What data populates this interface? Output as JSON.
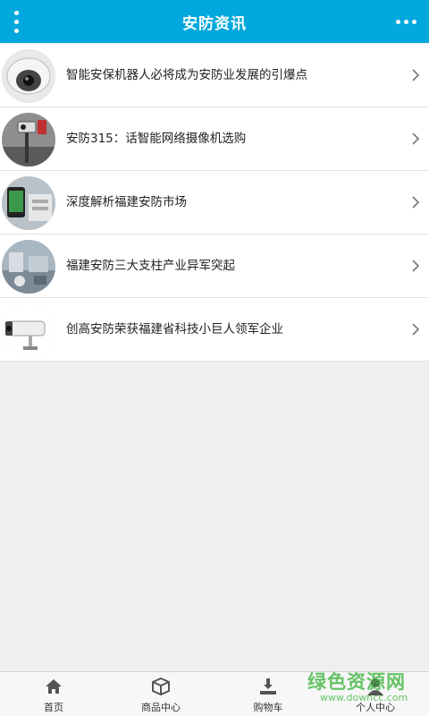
{
  "header": {
    "title": "安防资讯",
    "menu_icon": "vertical-dots-icon",
    "more_icon": "horizontal-dots-icon",
    "color": "#00a8de"
  },
  "news": [
    {
      "title": "智能安保机器人必将成为安防业发展的引爆点",
      "thumb": "dome-camera"
    },
    {
      "title": "安防315：话智能网络摄像机选购",
      "thumb": "camera-on-pole"
    },
    {
      "title": "深度解析福建安防市场",
      "thumb": "phone-device"
    },
    {
      "title": "福建安防三大支柱产业异军突起",
      "thumb": "factory-machines"
    },
    {
      "title": "创高安防荣获福建省科技小巨人领军企业",
      "thumb": "bullet-camera"
    }
  ],
  "tabbar": [
    {
      "label": "首页",
      "icon": "home-icon"
    },
    {
      "label": "商品中心",
      "icon": "box-icon"
    },
    {
      "label": "购物车",
      "icon": "download-tray-icon"
    },
    {
      "label": "个人中心",
      "icon": "user-icon"
    }
  ],
  "watermark": {
    "text": "绿色资源网",
    "url": "www.downcc.com"
  }
}
